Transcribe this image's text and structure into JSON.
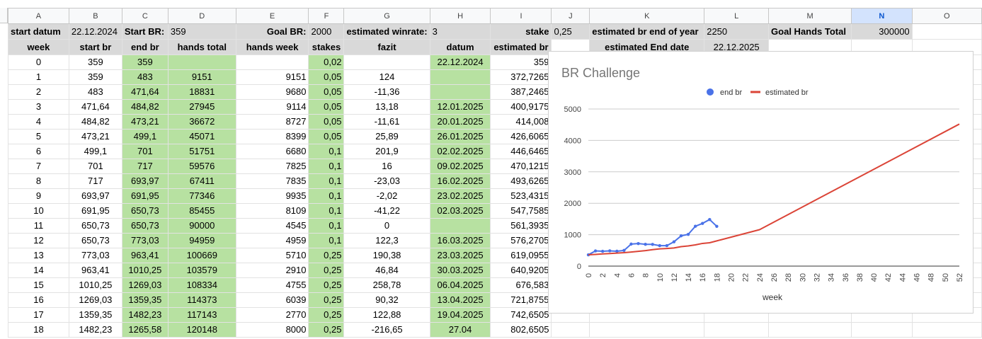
{
  "columns": [
    "A",
    "B",
    "C",
    "D",
    "E",
    "F",
    "G",
    "H",
    "I",
    "J",
    "K",
    "L",
    "M",
    "N",
    "O"
  ],
  "selected_column": "N",
  "info_row": {
    "start_datum_label": "start datum",
    "start_datum_value": "22.12.2024",
    "start_br_label": "Start BR:",
    "start_br_value": "359",
    "goal_br_label": "Goal BR:",
    "goal_br_value": "2000",
    "winrate_label": "estimated winrate:",
    "winrate_value": "3",
    "stake_label": "stake",
    "stake_value": "0,25",
    "br_end_label": "estimated br end of year",
    "br_end_value": "2250",
    "goal_hands_label": "Goal Hands Total",
    "goal_hands_value": "300000"
  },
  "headers": {
    "week": "week",
    "start_br": "start br",
    "end_br": "end br",
    "hands_total": "hands total",
    "hands_week": "hands week",
    "stakes": "stakes",
    "fazit": "fazit",
    "datum": "datum",
    "estimated_br": "estimated br",
    "end_date_label": "estimated End date",
    "end_date_value": "22.12.2025"
  },
  "rows": [
    {
      "week": "0",
      "start_br": "359",
      "end_br": "359",
      "hands_total": "",
      "hands_week": "",
      "stakes": "0,02",
      "fazit": "",
      "datum": "22.12.2024",
      "estimated_br": "359"
    },
    {
      "week": "1",
      "start_br": "359",
      "end_br": "483",
      "hands_total": "9151",
      "hands_week": "9151",
      "stakes": "0,05",
      "fazit": "124",
      "datum": "",
      "estimated_br": "372,7265"
    },
    {
      "week": "2",
      "start_br": "483",
      "end_br": "471,64",
      "hands_total": "18831",
      "hands_week": "9680",
      "stakes": "0,05",
      "fazit": "-11,36",
      "datum": "",
      "estimated_br": "387,2465"
    },
    {
      "week": "3",
      "start_br": "471,64",
      "end_br": "484,82",
      "hands_total": "27945",
      "hands_week": "9114",
      "stakes": "0,05",
      "fazit": "13,18",
      "datum": "12.01.2025",
      "estimated_br": "400,9175"
    },
    {
      "week": "4",
      "start_br": "484,82",
      "end_br": "473,21",
      "hands_total": "36672",
      "hands_week": "8727",
      "stakes": "0,05",
      "fazit": "-11,61",
      "datum": "20.01.2025",
      "estimated_br": "414,008"
    },
    {
      "week": "5",
      "start_br": "473,21",
      "end_br": "499,1",
      "hands_total": "45071",
      "hands_week": "8399",
      "stakes": "0,05",
      "fazit": "25,89",
      "datum": "26.01.2025",
      "estimated_br": "426,6065"
    },
    {
      "week": "6",
      "start_br": "499,1",
      "end_br": "701",
      "hands_total": "51751",
      "hands_week": "6680",
      "stakes": "0,1",
      "fazit": "201,9",
      "datum": "02.02.2025",
      "estimated_br": "446,6465"
    },
    {
      "week": "7",
      "start_br": "701",
      "end_br": "717",
      "hands_total": "59576",
      "hands_week": "7825",
      "stakes": "0,1",
      "fazit": "16",
      "datum": "09.02.2025",
      "estimated_br": "470,1215"
    },
    {
      "week": "8",
      "start_br": "717",
      "end_br": "693,97",
      "hands_total": "67411",
      "hands_week": "7835",
      "stakes": "0,1",
      "fazit": "-23,03",
      "datum": "16.02.2025",
      "estimated_br": "493,6265"
    },
    {
      "week": "9",
      "start_br": "693,97",
      "end_br": "691,95",
      "hands_total": "77346",
      "hands_week": "9935",
      "stakes": "0,1",
      "fazit": "-2,02",
      "datum": "23.02.2025",
      "estimated_br": "523,4315"
    },
    {
      "week": "10",
      "start_br": "691,95",
      "end_br": "650,73",
      "hands_total": "85455",
      "hands_week": "8109",
      "stakes": "0,1",
      "fazit": "-41,22",
      "datum": "02.03.2025",
      "estimated_br": "547,7585"
    },
    {
      "week": "11",
      "start_br": "650,73",
      "end_br": "650,73",
      "hands_total": "90000",
      "hands_week": "4545",
      "stakes": "0,1",
      "fazit": "0",
      "datum": "",
      "estimated_br": "561,3935"
    },
    {
      "week": "12",
      "start_br": "650,73",
      "end_br": "773,03",
      "hands_total": "94959",
      "hands_week": "4959",
      "stakes": "0,1",
      "fazit": "122,3",
      "datum": "16.03.2025",
      "estimated_br": "576,2705"
    },
    {
      "week": "13",
      "start_br": "773,03",
      "end_br": "963,41",
      "hands_total": "100669",
      "hands_week": "5710",
      "stakes": "0,25",
      "fazit": "190,38",
      "datum": "23.03.2025",
      "estimated_br": "619,0955"
    },
    {
      "week": "14",
      "start_br": "963,41",
      "end_br": "1010,25",
      "hands_total": "103579",
      "hands_week": "2910",
      "stakes": "0,25",
      "fazit": "46,84",
      "datum": "30.03.2025",
      "estimated_br": "640,9205"
    },
    {
      "week": "15",
      "start_br": "1010,25",
      "end_br": "1269,03",
      "hands_total": "108334",
      "hands_week": "4755",
      "stakes": "0,25",
      "fazit": "258,78",
      "datum": "06.04.2025",
      "estimated_br": "676,583"
    },
    {
      "week": "16",
      "start_br": "1269,03",
      "end_br": "1359,35",
      "hands_total": "114373",
      "hands_week": "6039",
      "stakes": "0,25",
      "fazit": "90,32",
      "datum": "13.04.2025",
      "estimated_br": "721,8755"
    },
    {
      "week": "17",
      "start_br": "1359,35",
      "end_br": "1482,23",
      "hands_total": "117143",
      "hands_week": "2770",
      "stakes": "0,25",
      "fazit": "122,88",
      "datum": "19.04.2025",
      "estimated_br": "742,6505"
    },
    {
      "week": "18",
      "start_br": "1482,23",
      "end_br": "1265,58",
      "hands_total": "120148",
      "hands_week": "8000",
      "stakes": "0,25",
      "fazit": "-216,65",
      "datum": "27.04",
      "estimated_br": "802,6505"
    }
  ],
  "chart_data": {
    "type": "line",
    "title": "BR Challenge",
    "xlabel": "week",
    "ylabel": "",
    "xlim": [
      0,
      52
    ],
    "ylim": [
      0,
      5000
    ],
    "yticks": [
      0,
      1000,
      2000,
      3000,
      4000,
      5000
    ],
    "xticks": [
      0,
      2,
      4,
      6,
      8,
      10,
      12,
      14,
      16,
      18,
      20,
      22,
      24,
      26,
      28,
      30,
      32,
      34,
      36,
      38,
      40,
      42,
      44,
      46,
      48,
      50,
      52
    ],
    "grid": true,
    "legend_position": "top",
    "series": [
      {
        "name": "end br",
        "color": "#4a72e8",
        "markers": true,
        "x": [
          0,
          1,
          2,
          3,
          4,
          5,
          6,
          7,
          8,
          9,
          10,
          11,
          12,
          13,
          14,
          15,
          16,
          17,
          18
        ],
        "y": [
          359,
          483,
          471.64,
          484.82,
          473.21,
          499.1,
          701,
          717,
          693.97,
          691.95,
          650.73,
          650.73,
          773.03,
          963.41,
          1010.25,
          1269.03,
          1359.35,
          1482.23,
          1265.58
        ]
      },
      {
        "name": "estimated br",
        "color": "#db4437",
        "markers": false,
        "x": [
          0,
          1,
          2,
          3,
          4,
          5,
          6,
          7,
          8,
          9,
          10,
          11,
          12,
          13,
          14,
          15,
          16,
          17,
          18,
          24,
          52
        ],
        "y": [
          359,
          372.73,
          387.25,
          400.92,
          414.01,
          426.61,
          446.65,
          470.12,
          493.63,
          523.43,
          547.76,
          561.39,
          576.27,
          619.1,
          640.92,
          676.58,
          721.88,
          742.65,
          802.65,
          1160,
          4520
        ]
      }
    ]
  }
}
